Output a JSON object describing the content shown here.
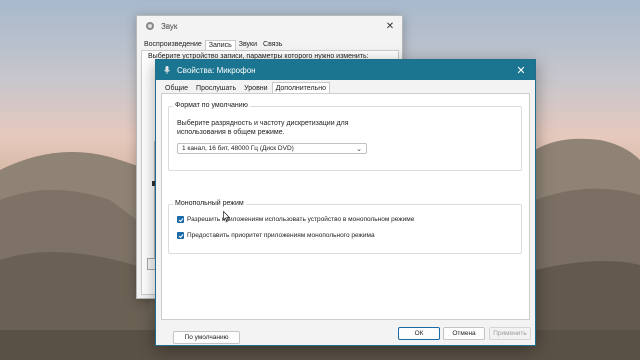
{
  "desktop": {
    "wallpaper": "rock-formation-sunset"
  },
  "sound_window": {
    "title": "Звук",
    "tabs": [
      "Воспроизведение",
      "Запись",
      "Звуки",
      "Связь"
    ],
    "active_tab_index": 1,
    "instruction": "Выберите устройство записи, параметры которого нужно изменить:"
  },
  "mic_window": {
    "title": "Свойства: Микрофон",
    "title_color": "#1b7590",
    "tabs": [
      "Общие",
      "Прослушать",
      "Уровни",
      "Дополнительно"
    ],
    "active_tab_index": 3,
    "default_format": {
      "group_title": "Формат по умолчанию",
      "description": "Выберите разрядность и частоту дискретизации для использования в общем режиме.",
      "selected_value": "1 канал, 16 бит, 48000 Гц (Диск DVD)"
    },
    "exclusive_mode": {
      "group_title": "Монопольный режим",
      "options": [
        {
          "label": "Разрешить приложениям использовать устройство в монопольном режиме",
          "checked": true
        },
        {
          "label": "Предоставить приоритет приложениям монопольного режима",
          "checked": true
        }
      ]
    },
    "restore_default_label": "По умолчанию",
    "buttons": {
      "ok": "ОК",
      "cancel": "Отмена",
      "apply": "Применить"
    },
    "accent_color": "#1b6aa8"
  }
}
